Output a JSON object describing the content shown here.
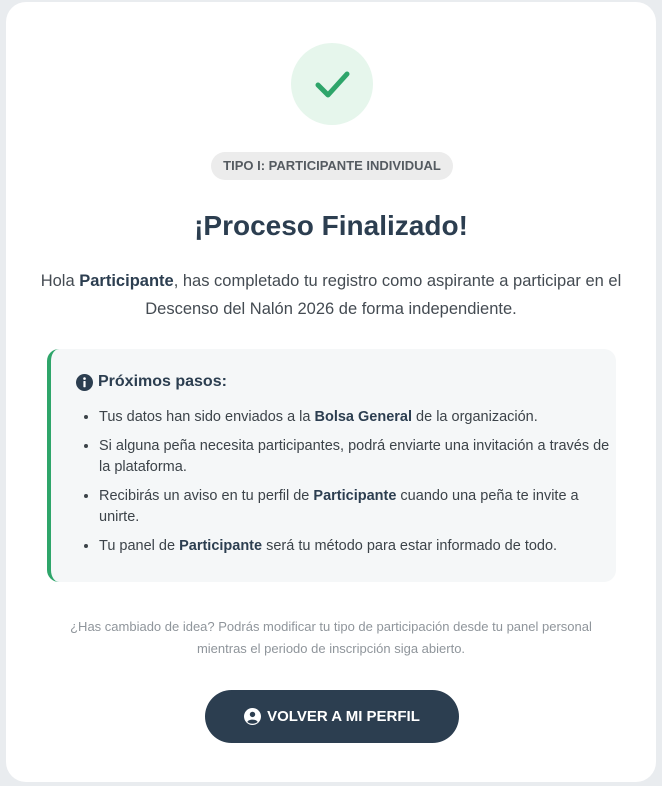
{
  "badge": "TIPO I: PARTICIPANTE INDIVIDUAL",
  "title": "¡Proceso Finalizado!",
  "intro": {
    "greeting": "Hola ",
    "role": "Participante",
    "text": ", has completado tu registro como aspirante a participar en el Descenso del Nalón 2026 de forma independiente."
  },
  "next_steps": {
    "heading": "Próximos pasos:",
    "items": [
      {
        "pre": "Tus datos han sido enviados a la ",
        "bold": "Bolsa General",
        "post": " de la organización."
      },
      {
        "pre": "Si alguna peña necesita participantes, podrá enviarte una invitación a través de la plataforma.",
        "bold": "",
        "post": ""
      },
      {
        "pre": "Recibirás un aviso en tu perfil de ",
        "bold": "Participante",
        "post": " cuando una peña te invite a unirte."
      },
      {
        "pre": "Tu panel de ",
        "bold": "Participante",
        "post": " será tu método para estar informado de todo."
      }
    ]
  },
  "note": "¿Has cambiado de idea? Podrás modificar tu tipo de participación desde tu panel personal mientras el periodo de inscripción siga abierto.",
  "button": {
    "label": "VOLVER A MI PERFIL",
    "icon": "user-circle-icon"
  },
  "colors": {
    "accent_green": "#2ea56a",
    "check_bg": "#e6f6ec",
    "dark": "#2c3e50",
    "panel_bg": "#f5f7f8"
  }
}
